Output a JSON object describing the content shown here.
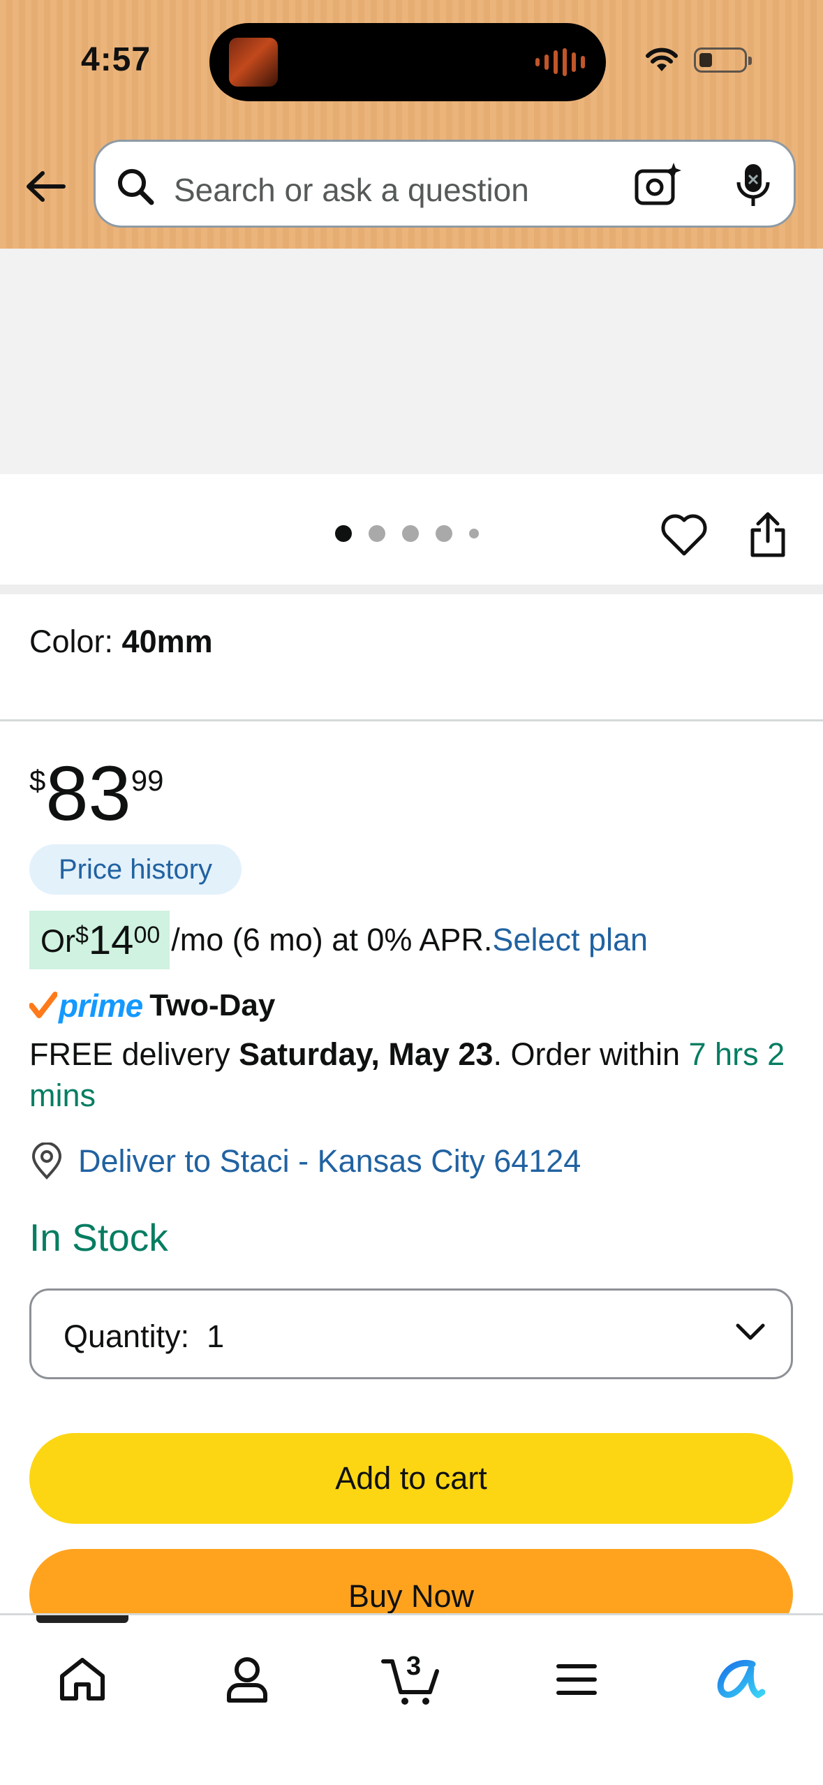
{
  "status_bar": {
    "time": "4:57"
  },
  "search": {
    "placeholder": "Search or ask a question"
  },
  "carousel": {
    "dot_count": 5,
    "active_index": 0
  },
  "product": {
    "color_label": "Color: ",
    "color_value": "40mm",
    "price": {
      "currency": "$",
      "whole": "83",
      "fraction": "99"
    },
    "price_history_label": "Price history",
    "installment": {
      "prefix": "Or ",
      "currency": "$",
      "whole": "14",
      "fraction": "00",
      "terms": "/mo (6 mo) at 0% APR. ",
      "select_plan": "Select plan"
    },
    "prime": {
      "word": "prime",
      "tier": "Two-Day"
    },
    "delivery": {
      "prefix": "FREE delivery ",
      "date": "Saturday, May 23",
      "middle": ". Order within ",
      "countdown": "7 hrs 2 mins"
    },
    "deliver_to": "Deliver to Staci - Kansas City 64124",
    "stock_status": "In Stock",
    "quantity_label": "Quantity:",
    "quantity_value": "1",
    "add_to_cart": "Add to cart",
    "buy_now": "Buy Now"
  },
  "bottom_nav": {
    "cart_count": "3",
    "active_tab": "home"
  },
  "colors": {
    "header_bg": "#ebb47b",
    "link": "#2162a1",
    "stock_green": "#067d62",
    "add_to_cart": "#fcd613",
    "buy_now": "#ffa31f",
    "prime_blue": "#1399ff",
    "prime_check": "#ff7a1a"
  }
}
